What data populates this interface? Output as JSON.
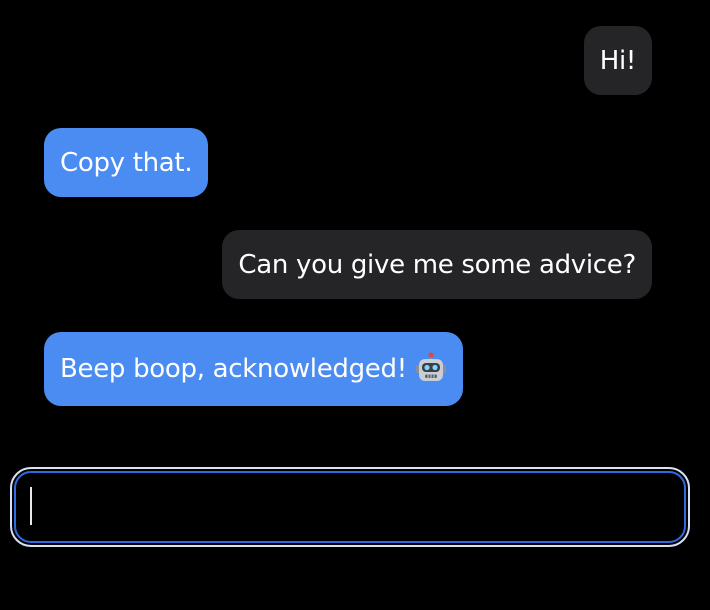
{
  "messages": [
    {
      "sender": "user",
      "text": "Hi!"
    },
    {
      "sender": "bot",
      "text": "Copy that."
    },
    {
      "sender": "user",
      "text": "Can you give me some advice?"
    },
    {
      "sender": "bot",
      "text": "Beep boop, acknowledged!",
      "emoji_icon": "robot-face-icon"
    }
  ],
  "composer": {
    "value": "",
    "placeholder": "",
    "focused": true
  },
  "colors": {
    "background": "#000000",
    "user_bubble": "#252528",
    "bot_bubble": "#4a8cf1",
    "input_focus_ring": "#2f6be0",
    "text": "#ffffff"
  }
}
